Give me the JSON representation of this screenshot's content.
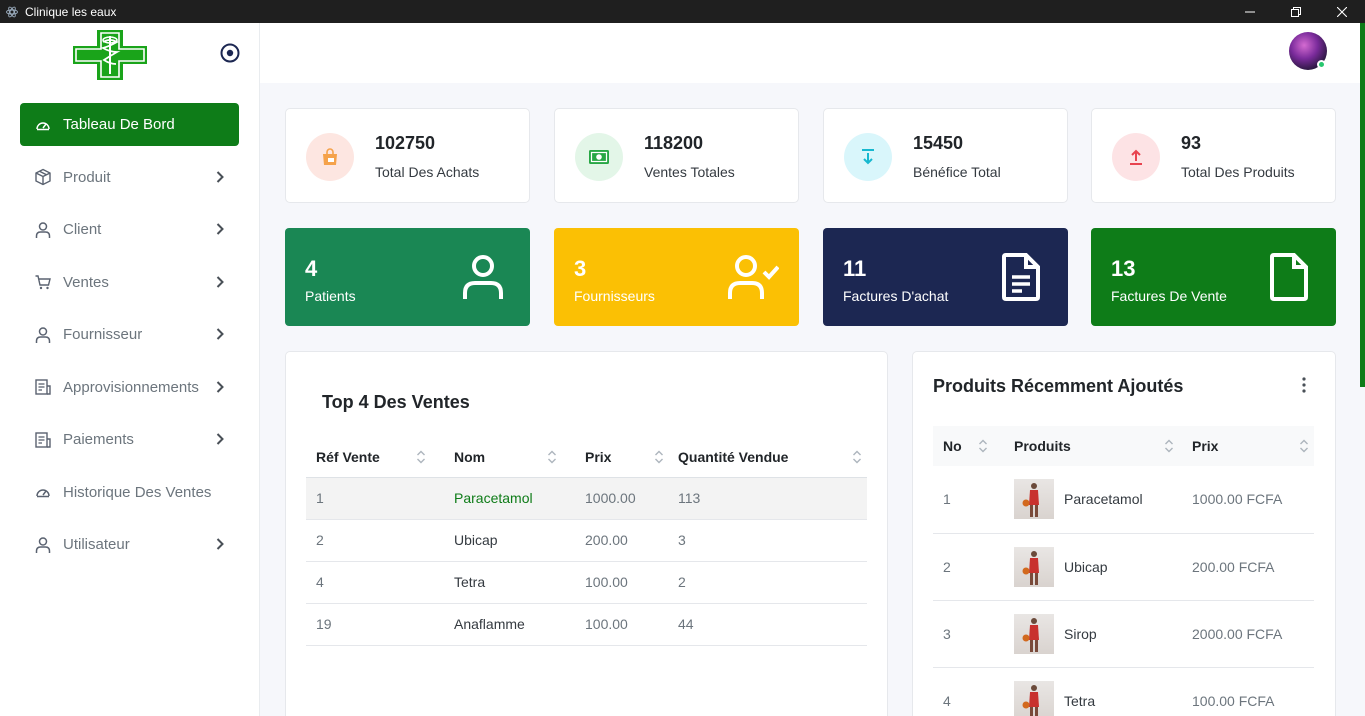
{
  "window": {
    "title": "Clinique les eaux"
  },
  "colors": {
    "primary": "#0e7c18",
    "teal": "#1a8754",
    "yellow": "#fbc004",
    "navy": "#1c2752"
  },
  "sidebar": {
    "items": [
      {
        "label": "Tableau De Bord",
        "icon": "dashboard-icon",
        "active": true,
        "chevron": false
      },
      {
        "label": "Produit",
        "icon": "box-icon",
        "chevron": true
      },
      {
        "label": "Client",
        "icon": "user-icon",
        "chevron": true
      },
      {
        "label": "Ventes",
        "icon": "cart-icon",
        "chevron": true
      },
      {
        "label": "Fournisseur",
        "icon": "user-icon",
        "chevron": true
      },
      {
        "label": "Approvisionnements",
        "icon": "document-icon",
        "chevron": true
      },
      {
        "label": "Paiements",
        "icon": "document-icon",
        "chevron": true
      },
      {
        "label": "Historique Des Ventes",
        "icon": "dashboard-icon",
        "chevron": false
      },
      {
        "label": "Utilisateur",
        "icon": "user-icon",
        "chevron": true
      }
    ]
  },
  "stats": [
    {
      "value": "102750",
      "label": "Total Des Achats",
      "icon": "shopping-bag-icon"
    },
    {
      "value": "118200",
      "label": "Ventes Totales",
      "icon": "money-icon"
    },
    {
      "value": "15450",
      "label": "Bénéfice Total",
      "icon": "download-icon"
    },
    {
      "value": "93",
      "label": "Total Des Produits",
      "icon": "upload-icon"
    }
  ],
  "counts": [
    {
      "value": "4",
      "label": "Patients",
      "icon": "user-icon"
    },
    {
      "value": "3",
      "label": "Fournisseurs",
      "icon": "user-check-icon"
    },
    {
      "value": "11",
      "label": "Factures D'achat",
      "icon": "file-text-icon"
    },
    {
      "value": "13",
      "label": "Factures De Vente",
      "icon": "file-icon"
    }
  ],
  "top_sales": {
    "title": "Top 4 Des Ventes",
    "headers": [
      "Réf Vente",
      "Nom",
      "Prix",
      "Quantité Vendue"
    ],
    "rows": [
      [
        "1",
        "Paracetamol",
        "1000.00",
        "113"
      ],
      [
        "2",
        "Ubicap",
        "200.00",
        "3"
      ],
      [
        "4",
        "Tetra",
        "100.00",
        "2"
      ],
      [
        "19",
        "Anaflamme",
        "100.00",
        "44"
      ]
    ]
  },
  "recent_products": {
    "title": "Produits Récemment Ajoutés",
    "headers": [
      "No",
      "Produits",
      "Prix"
    ],
    "rows": [
      [
        "1",
        "Paracetamol",
        "1000.00 FCFA"
      ],
      [
        "2",
        "Ubicap",
        "200.00 FCFA"
      ],
      [
        "3",
        "Sirop",
        "2000.00 FCFA"
      ],
      [
        "4",
        "Tetra",
        "100.00 FCFA"
      ]
    ]
  }
}
